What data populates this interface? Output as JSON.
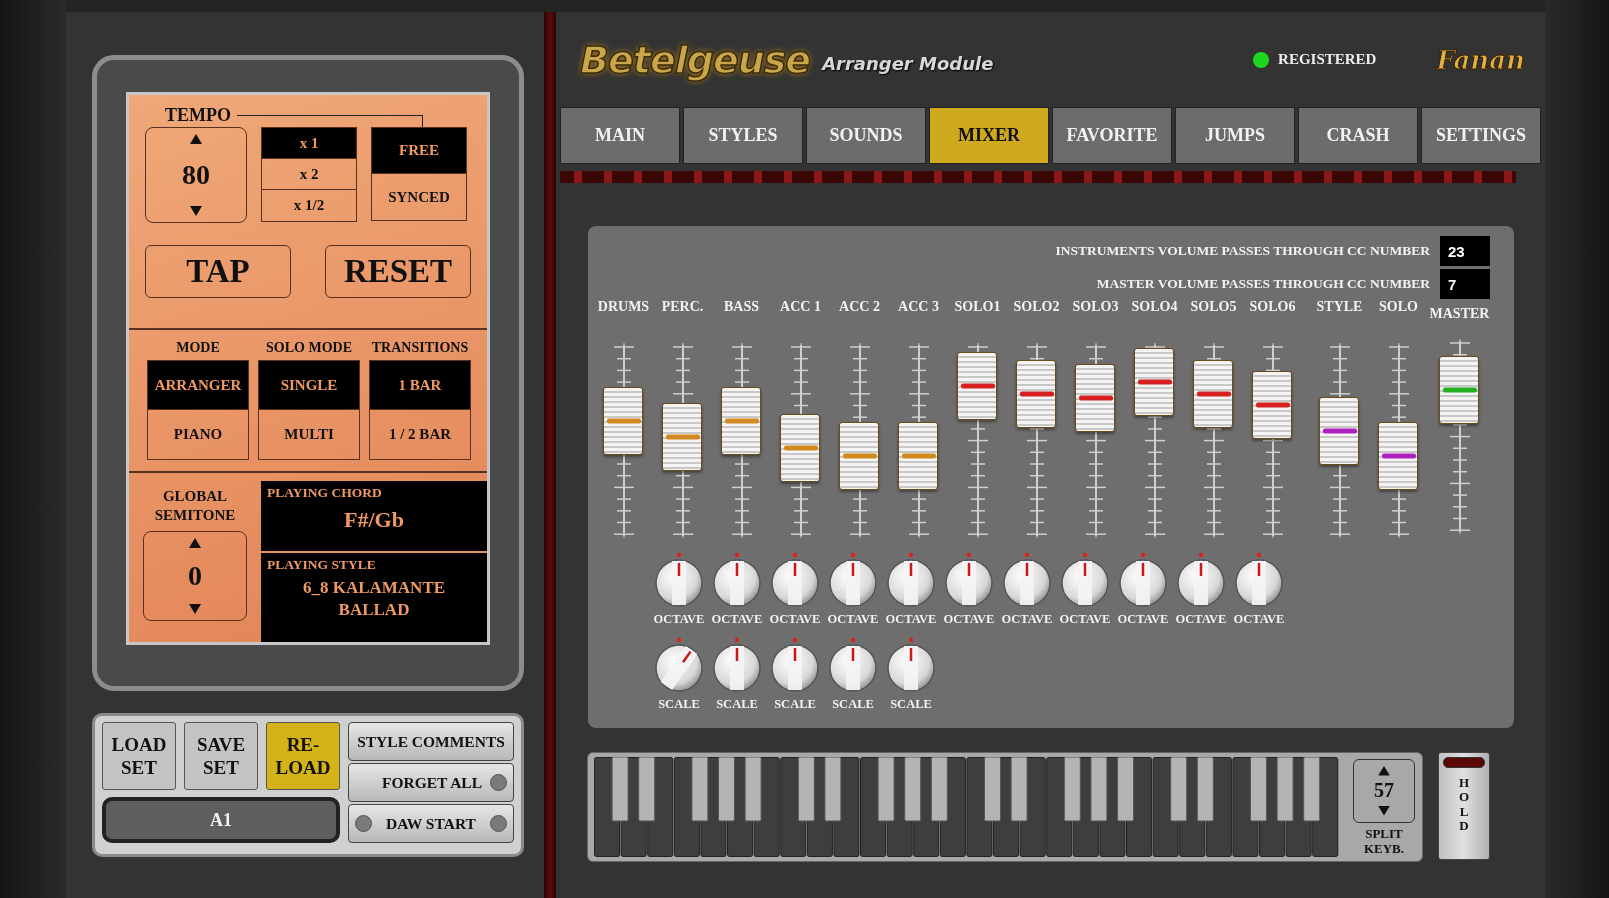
{
  "tempo": {
    "label": "TEMPO",
    "value": "80",
    "multipliers": [
      {
        "label": "x 1",
        "selected": true
      },
      {
        "label": "x 2",
        "selected": false
      },
      {
        "label": "x 1/2",
        "selected": false
      }
    ],
    "sync": [
      {
        "label": "FREE",
        "selected": true
      },
      {
        "label": "SYNCED",
        "selected": false
      }
    ]
  },
  "tempo_buttons": [
    "TAP",
    "RESET"
  ],
  "modes": [
    {
      "label": "MODE",
      "options": [
        {
          "label": "ARRANGER",
          "selected": true
        },
        {
          "label": "PIANO",
          "selected": false
        }
      ]
    },
    {
      "label": "SOLO MODE",
      "options": [
        {
          "label": "SINGLE",
          "selected": true
        },
        {
          "label": "MULTI",
          "selected": false
        }
      ]
    },
    {
      "label": "TRANSITIONS",
      "options": [
        {
          "label": "1 BAR",
          "selected": true
        },
        {
          "label": "1 / 2 BAR",
          "selected": false
        }
      ]
    }
  ],
  "global_semitone": {
    "label": "GLOBAL SEMITONE",
    "value": "0"
  },
  "playing_chord": {
    "label": "PLAYING CHORD",
    "value": "F#/Gb"
  },
  "playing_style": {
    "label": "PLAYING STYLE",
    "value": "6_8 KALAMANTE BALLAD"
  },
  "set_buttons": [
    {
      "label": "LOAD SET",
      "selected": false
    },
    {
      "label": "SAVE SET",
      "selected": false
    },
    {
      "label": "RE-LOAD",
      "selected": true
    }
  ],
  "set_name": "A1",
  "side_buttons": [
    {
      "label": "STYLE COMMENTS",
      "kind": "plain"
    },
    {
      "label": "FORGET ALL",
      "kind": "led-right",
      "on": false
    },
    {
      "label": "DAW START",
      "kind": "led-both",
      "on": false
    }
  ],
  "header": {
    "logo": "Betelgeuse",
    "subtitle": "Arranger Module",
    "status": {
      "label": "REGISTERED",
      "on": true
    },
    "brand": "Fanan"
  },
  "tabs": [
    {
      "label": "MAIN",
      "selected": false
    },
    {
      "label": "STYLES",
      "selected": false
    },
    {
      "label": "SOUNDS",
      "selected": false
    },
    {
      "label": "MIXER",
      "selected": true
    },
    {
      "label": "FAVORITE",
      "selected": false
    },
    {
      "label": "JUMPS",
      "selected": false
    },
    {
      "label": "CRASH",
      "selected": false
    },
    {
      "label": "SETTINGS",
      "selected": false
    }
  ],
  "cc_settings": [
    {
      "label": "INSTRUMENTS VOLUME PASSES THROUGH CC NUMBER",
      "value": "23"
    },
    {
      "label": "MASTER VOLUME PASSES THROUGH CC NUMBER",
      "value": "7"
    }
  ],
  "faders": [
    {
      "label": "DRUMS",
      "level": 0.6,
      "color": "#d08a1e"
    },
    {
      "label": "PERC.",
      "level": 0.52,
      "color": "#d08a1e"
    },
    {
      "label": "BASS",
      "level": 0.6,
      "color": "#d08a1e"
    },
    {
      "label": "ACC 1",
      "level": 0.46,
      "color": "#d08a1e"
    },
    {
      "label": "ACC 2",
      "level": 0.42,
      "color": "#d08a1e"
    },
    {
      "label": "ACC 3",
      "level": 0.42,
      "color": "#d08a1e"
    },
    {
      "label": "SOLO1",
      "level": 0.78,
      "color": "#d62020"
    },
    {
      "label": "SOLO2",
      "level": 0.74,
      "color": "#d62020"
    },
    {
      "label": "SOLO3",
      "level": 0.72,
      "color": "#d62020"
    },
    {
      "label": "SOLO4",
      "level": 0.8,
      "color": "#d62020"
    },
    {
      "label": "SOLO5",
      "level": 0.74,
      "color": "#d62020"
    },
    {
      "label": "SOLO6",
      "level": 0.68,
      "color": "#d62020"
    },
    {
      "label": "STYLE",
      "level": 0.55,
      "color": "#b020c0"
    },
    {
      "label": "SOLO",
      "level": 0.42,
      "color": "#b020c0"
    },
    {
      "label": "MASTER",
      "level": 0.74,
      "color": "#20b020"
    }
  ],
  "octave_knobs": [
    {
      "label": "OCTAVE",
      "centered": true
    },
    {
      "label": "OCTAVE",
      "centered": true
    },
    {
      "label": "OCTAVE",
      "centered": true
    },
    {
      "label": "OCTAVE",
      "centered": true
    },
    {
      "label": "OCTAVE",
      "centered": true
    },
    {
      "label": "OCTAVE",
      "centered": true
    },
    {
      "label": "OCTAVE",
      "centered": true
    },
    {
      "label": "OCTAVE",
      "centered": true
    },
    {
      "label": "OCTAVE",
      "centered": true
    },
    {
      "label": "OCTAVE",
      "centered": true
    },
    {
      "label": "OCTAVE",
      "centered": true
    }
  ],
  "scale_knobs": [
    {
      "label": "SCALE",
      "centered": false
    },
    {
      "label": "SCALE",
      "centered": true
    },
    {
      "label": "SCALE",
      "centered": true
    },
    {
      "label": "SCALE",
      "centered": true
    },
    {
      "label": "SCALE",
      "centered": true
    }
  ],
  "split": {
    "label": "SPLIT KEYB.",
    "value": "57"
  },
  "hold": {
    "label": "HOLD",
    "on": false
  }
}
